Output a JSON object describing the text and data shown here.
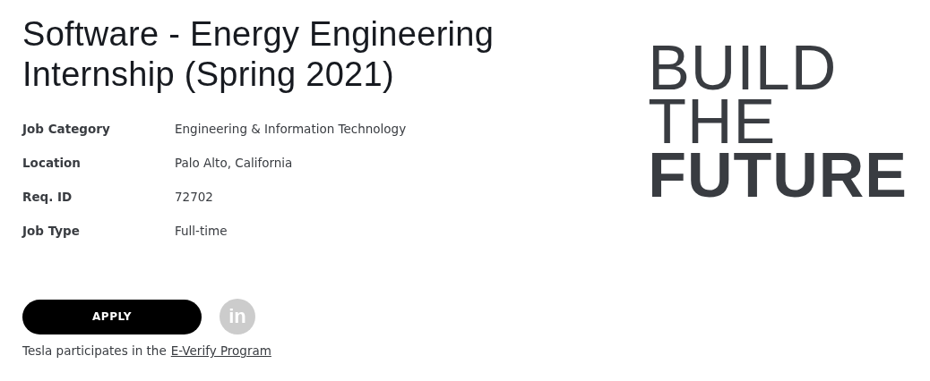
{
  "title": "Software - Energy Engineering Internship (Spring 2021)",
  "details": [
    {
      "label": "Job Category",
      "value": "Engineering & Information Technology"
    },
    {
      "label": "Location",
      "value": "Palo Alto, California"
    },
    {
      "label": "Req. ID",
      "value": "72702"
    },
    {
      "label": "Job Type",
      "value": "Full-time"
    }
  ],
  "apply_button": "APPLY",
  "share_button": "in",
  "notice": {
    "text": "Tesla participates in the",
    "link": "E-Verify Program"
  },
  "tagline": [
    {
      "text": "BUILD",
      "emphasis": false
    },
    {
      "text": "THE",
      "emphasis": false
    },
    {
      "text": "FUTURE",
      "emphasis": true
    }
  ]
}
